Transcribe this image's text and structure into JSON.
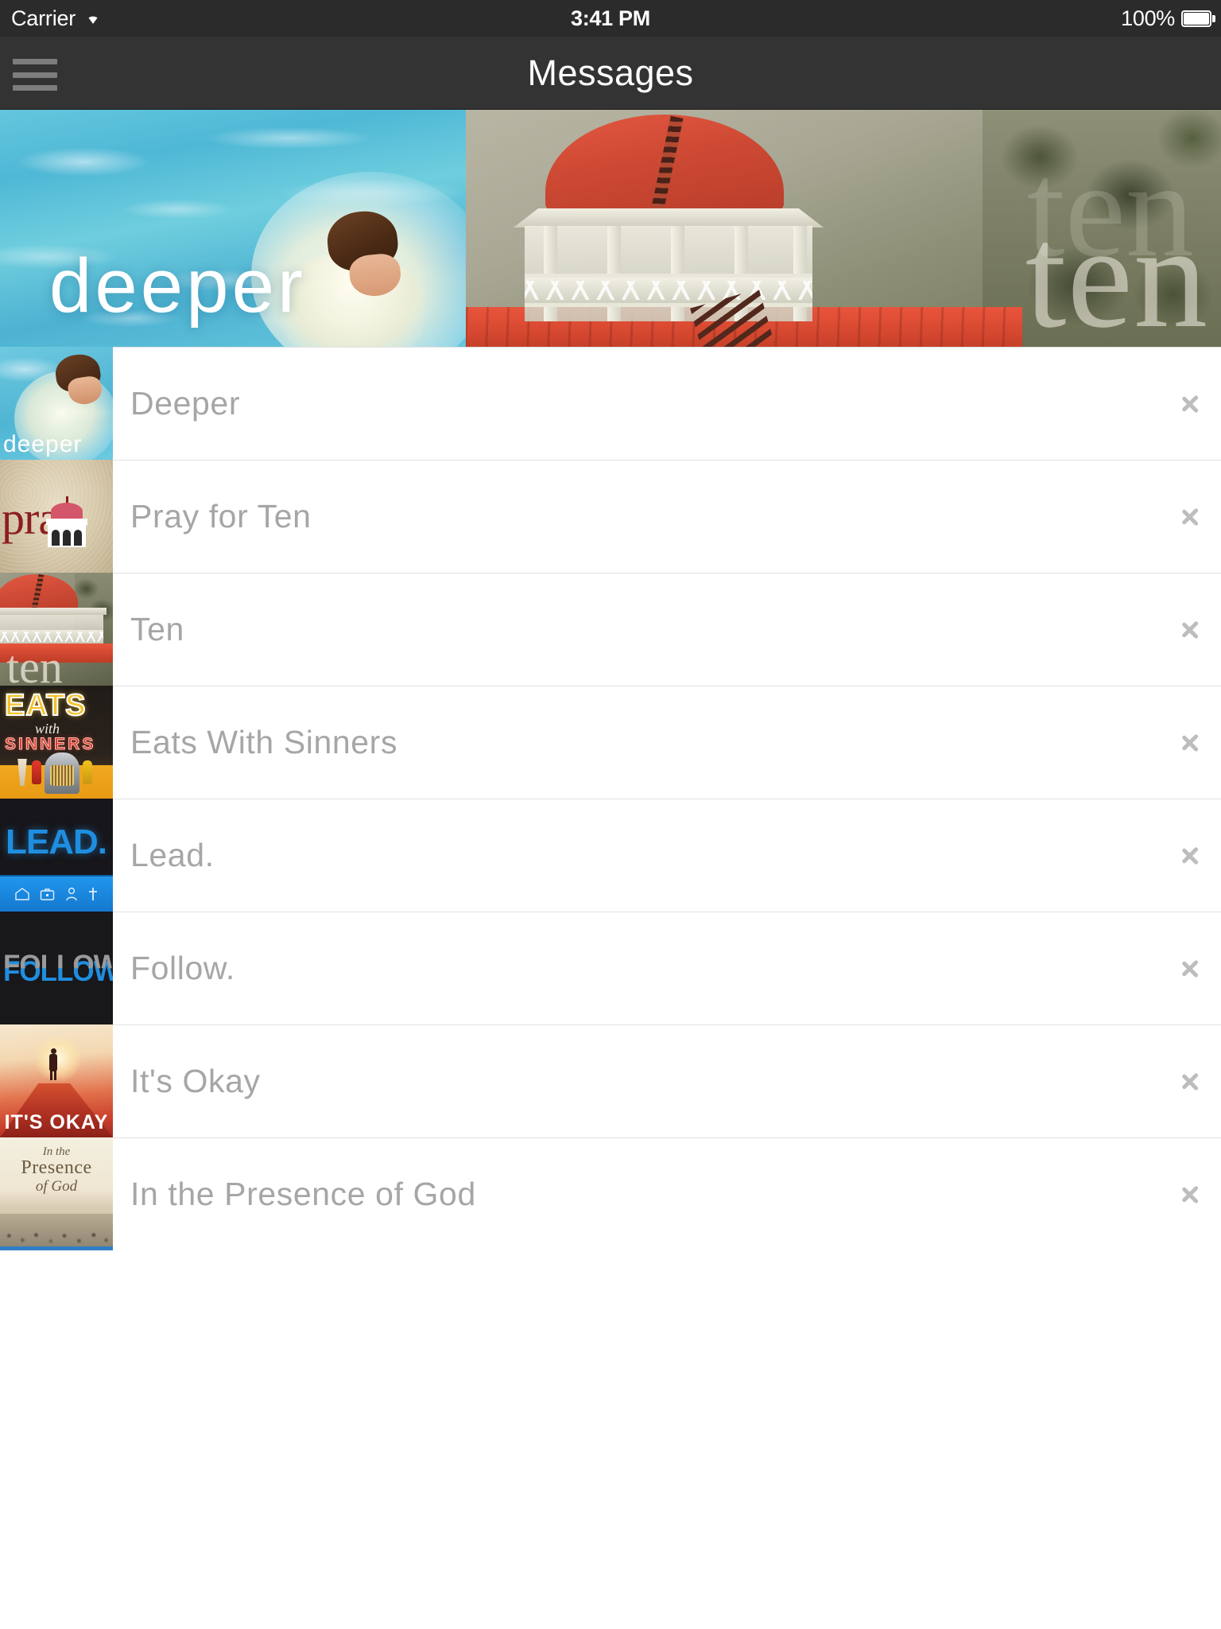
{
  "status_bar": {
    "carrier": "Carrier",
    "wifi_icon": "wifi-icon",
    "time": "3:41 PM",
    "battery_percent": "100%",
    "battery_icon": "battery-icon"
  },
  "nav_bar": {
    "menu_icon": "hamburger-menu-icon",
    "title": "Messages"
  },
  "hero": [
    {
      "id": "deeper",
      "overlay_text": "deeper",
      "description": "boy splashing in blue pool water"
    },
    {
      "id": "ten",
      "overlay_text": "ten",
      "description": "red domed gazebo cupola among trees"
    }
  ],
  "list": {
    "rows": [
      {
        "title": "Deeper",
        "thumb_text": "deeper",
        "chevron": "chevron-right-icon"
      },
      {
        "title": "Pray for Ten",
        "thumb_text": "pray",
        "chevron": "chevron-right-icon"
      },
      {
        "title": "Ten",
        "thumb_text": "ten",
        "chevron": "chevron-right-icon"
      },
      {
        "title": "Eats With Sinners",
        "thumb_text": "EATS with SINNERS",
        "chevron": "chevron-right-icon"
      },
      {
        "title": "Lead.",
        "thumb_text": "LEAD.",
        "chevron": "chevron-right-icon"
      },
      {
        "title": "Follow.",
        "thumb_text": "FOLLOW.",
        "chevron": "chevron-right-icon"
      },
      {
        "title": "It's Okay",
        "thumb_text": "IT'S OKAY",
        "chevron": "chevron-right-icon"
      },
      {
        "title": "In the Presence of God",
        "thumb_text": "In the Presence of God",
        "chevron": "chevron-right-icon"
      }
    ]
  },
  "thumb_art": {
    "eats": {
      "line1": "EATS",
      "line2": "with",
      "line3": "SINNERS"
    },
    "lead": {
      "word": "LEAD.",
      "icons": [
        "home-icon",
        "briefcase-icon",
        "person-icon",
        "cross-icon"
      ]
    },
    "follow": {
      "word": "FOLLOW."
    },
    "okay": {
      "word": "IT'S OKAY"
    },
    "presence": {
      "line1": "In the",
      "line2": "Presence",
      "line3": "of God"
    }
  },
  "colors": {
    "status_bar_bg": "#2b2b2b",
    "nav_bar_bg": "#333333",
    "row_title": "#a6a6a6",
    "chevron": "#bdbdbd",
    "accent_blue": "#1f8ee0",
    "accent_red": "#cf4a34"
  }
}
